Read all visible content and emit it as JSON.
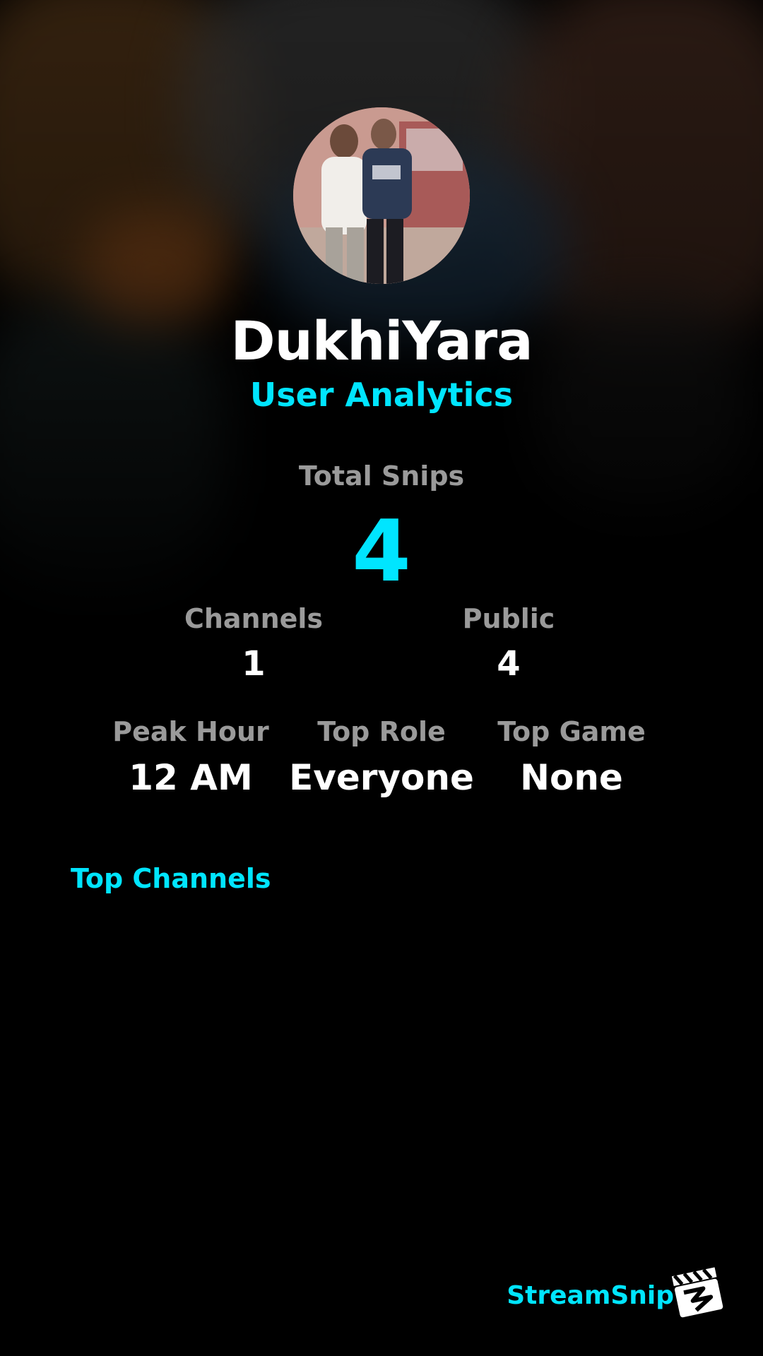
{
  "profile": {
    "username": "DukhiYara",
    "subtitle": "User Analytics"
  },
  "stats": {
    "total": {
      "label": "Total Snips",
      "value": "4"
    },
    "channels": {
      "label": "Channels",
      "value": "1"
    },
    "public": {
      "label": "Public",
      "value": "4"
    },
    "peak_hour": {
      "label": "Peak Hour",
      "value": "12 AM"
    },
    "top_role": {
      "label": "Top Role",
      "value": "Everyone"
    },
    "top_game": {
      "label": "Top Game",
      "value": "None"
    }
  },
  "sections": {
    "top_channels_title": "Top Channels"
  },
  "branding": {
    "name": "StreamSnip",
    "logo_icon": "clapperboard-icon"
  },
  "colors": {
    "accent": "#00e5ff",
    "label_gray": "#9a9a9a",
    "background": "#000000"
  }
}
